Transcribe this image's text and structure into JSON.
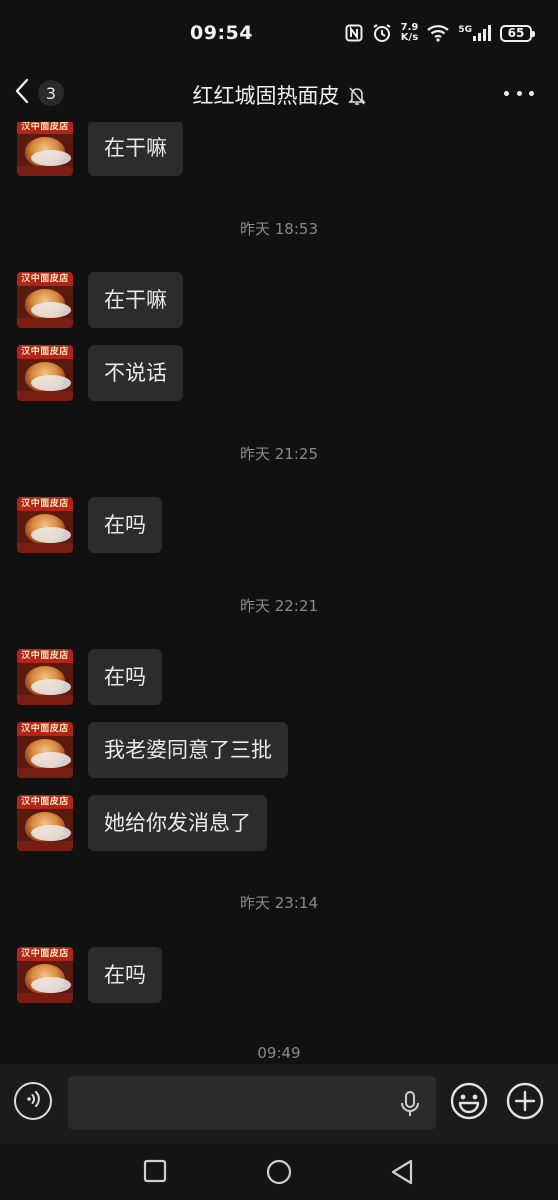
{
  "status_bar": {
    "time": "09:54",
    "net_speed_value": "7.9",
    "net_speed_unit": "K/s",
    "network": "5G",
    "battery": "65"
  },
  "header": {
    "unread_count": "3",
    "title": "红红城固热面皮"
  },
  "contact": {
    "avatar_text_top": "汉中面皮店"
  },
  "messages": [
    {
      "type": "text",
      "text": "在干嘛"
    },
    {
      "type": "time",
      "text": "昨天 18:53"
    },
    {
      "type": "text",
      "text": "在干嘛"
    },
    {
      "type": "text",
      "text": "不说话"
    },
    {
      "type": "time",
      "text": "昨天 21:25"
    },
    {
      "type": "text",
      "text": "在吗"
    },
    {
      "type": "time",
      "text": "昨天 22:21"
    },
    {
      "type": "text",
      "text": "在吗"
    },
    {
      "type": "text",
      "text": "我老婆同意了三批"
    },
    {
      "type": "text",
      "text": "她给你发消息了"
    },
    {
      "type": "time",
      "text": "昨天 23:14"
    },
    {
      "type": "text",
      "text": "在吗"
    },
    {
      "type": "time",
      "text": "09:49"
    }
  ],
  "input": {
    "value": "",
    "placeholder": ""
  },
  "icons": {
    "back": "chevron-left-icon",
    "mute": "bell-off-icon",
    "more": "more-dots-icon",
    "voice": "voice-wave-icon",
    "mic": "microphone-icon",
    "emoji": "smiley-icon",
    "plus": "plus-circle-icon",
    "nav_recent": "square-icon",
    "nav_home": "circle-icon",
    "nav_back": "triangle-back-icon"
  },
  "colors": {
    "background": "#111111",
    "bubble": "#2c2c2c",
    "timestamp": "#8a8a8a"
  }
}
